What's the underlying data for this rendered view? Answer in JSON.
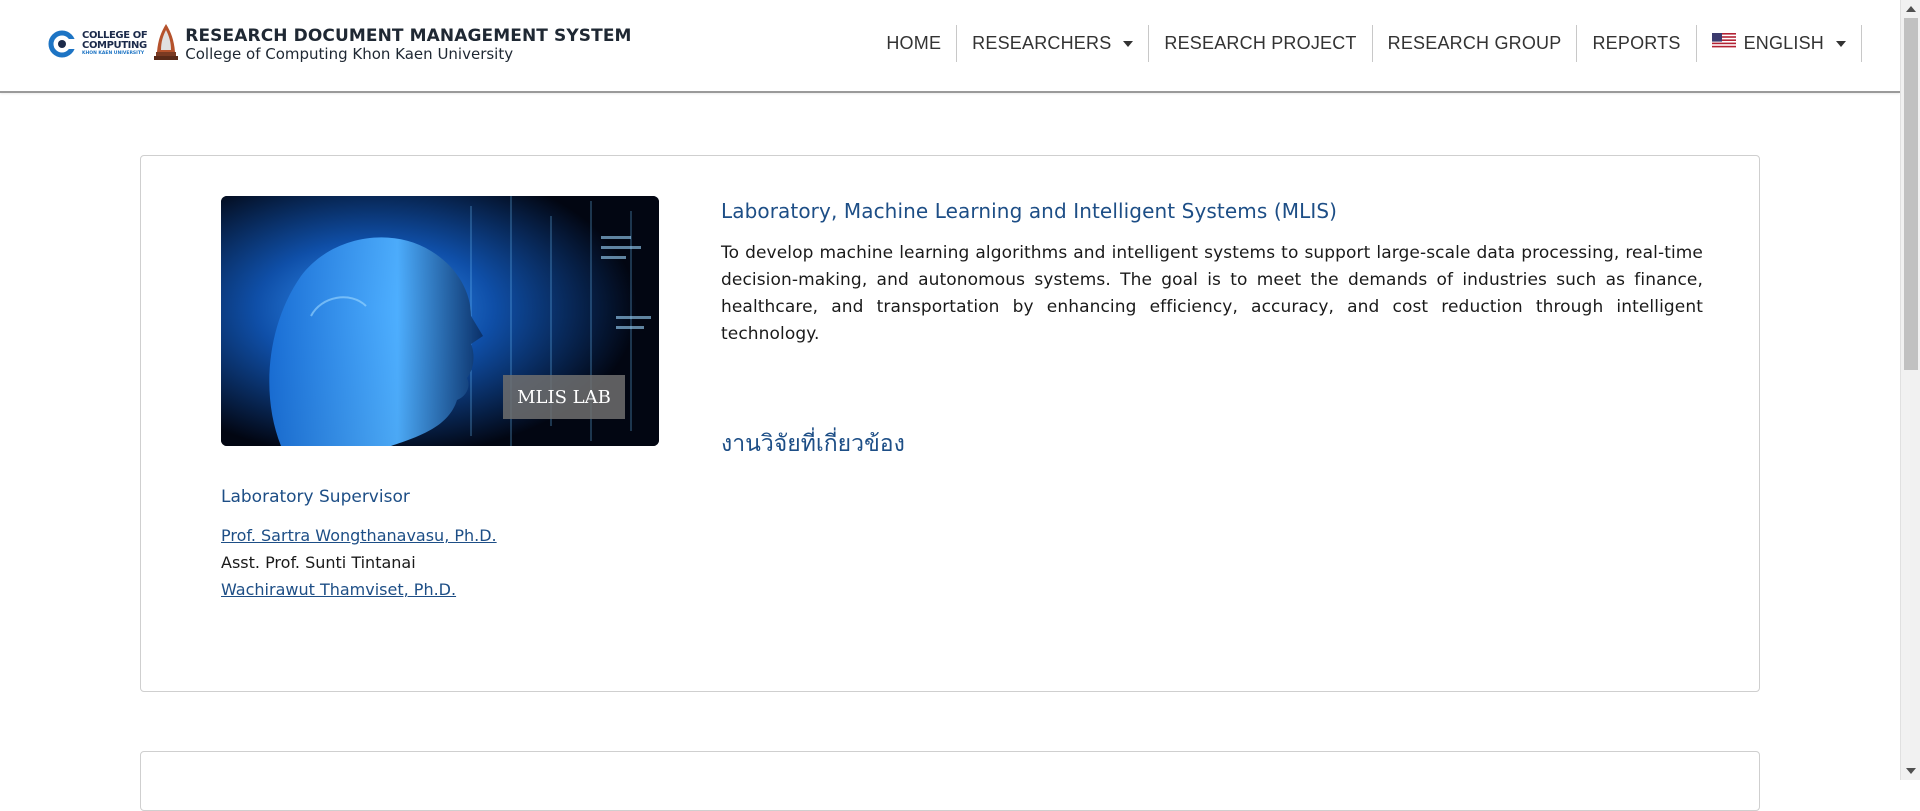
{
  "header": {
    "logo": {
      "line1": "COLLEGE OF",
      "line2": "COMPUTING",
      "line3": "KHON KAEN UNIVERSITY"
    },
    "title": "RESEARCH DOCUMENT MANAGEMENT SYSTEM",
    "subtitle": "College of Computing Khon Kaen University"
  },
  "nav": {
    "home": "HOME",
    "researchers": "RESEARCHERS",
    "research_project": "RESEARCH PROJECT",
    "research_group": "RESEARCH GROUP",
    "reports": "REPORTS",
    "language": "ENGLISH"
  },
  "lab": {
    "image_label": "MLIS LAB",
    "title": "Laboratory, Machine Learning and Intelligent Systems (MLIS)",
    "description": "To develop machine learning algorithms and intelligent systems to support large-scale data processing, real-time decision-making, and autonomous systems. The goal is to meet the demands of industries such as finance, healthcare, and transportation by enhancing efficiency, accuracy, and cost reduction through intelligent technology.",
    "related_heading": "งานวิจัยที่เกี่ยวข้อง",
    "supervisor_heading": "Laboratory Supervisor",
    "supervisors": [
      "Prof. Sartra Wongthanavasu, Ph.D.",
      "Asst. Prof. Sunti Tintanai",
      "Wachirawut Thamviset, Ph.D."
    ]
  },
  "colors": {
    "accent": "#1d4e86",
    "text": "#1a1a1a",
    "border": "#cfcfcf"
  }
}
